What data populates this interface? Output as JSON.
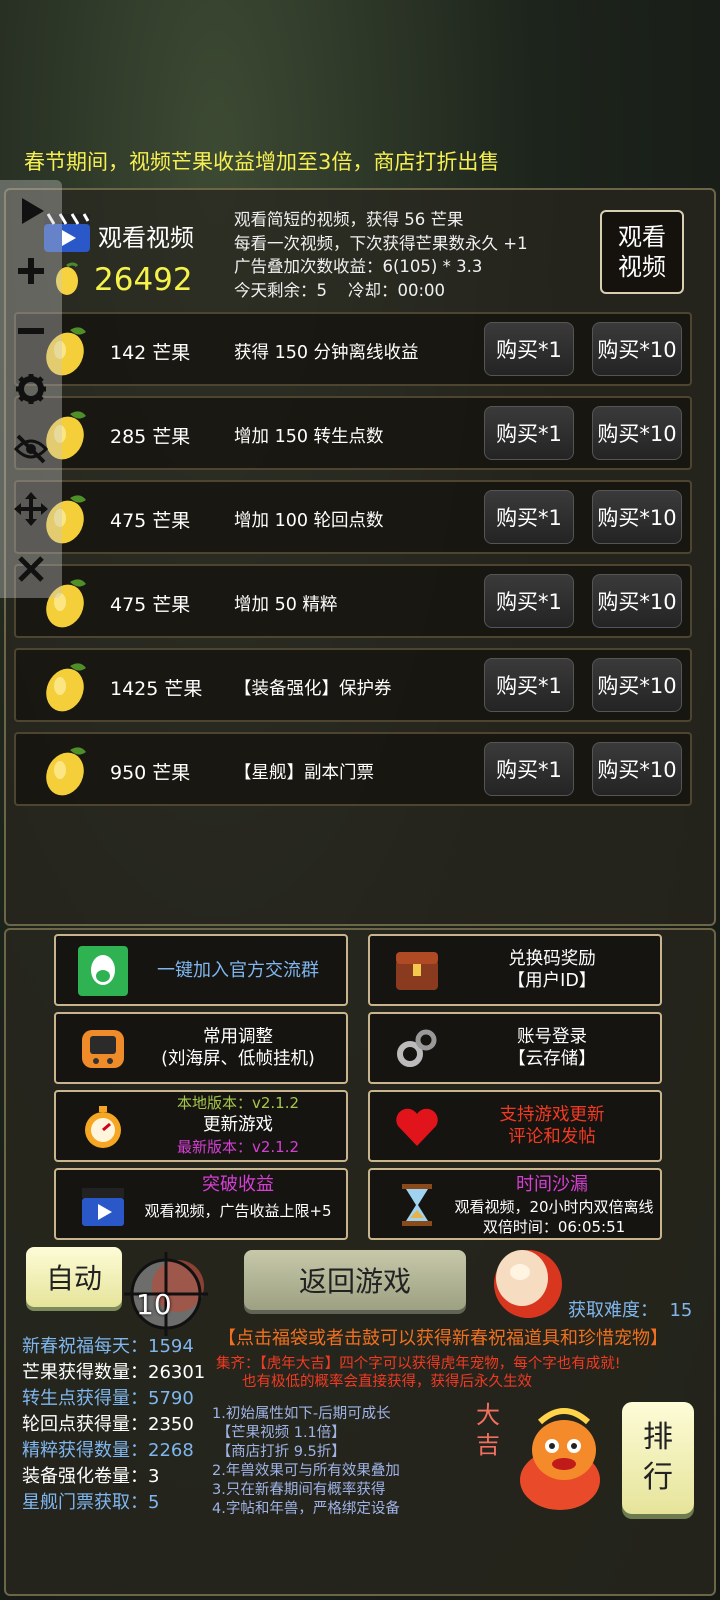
{
  "banner": "春节期间，视频芒果收益增加至3倍，商店打折出售",
  "video": {
    "title": "观看视频",
    "mango_count": "26492",
    "info": [
      "观看简短的视频，获得 56 芒果",
      "每看一次视频，下次获得芒果数永久 +1",
      "广告叠加次数收益：6(105) * 3.3",
      "今天剩余：5    冷却：00:00"
    ],
    "watch_button": "观看\n视频"
  },
  "shop_items": [
    {
      "price": "142 芒果",
      "desc": "获得 150 分钟离线收益",
      "buy1": "购买*1",
      "buy10": "购买*10"
    },
    {
      "price": "285 芒果",
      "desc": "增加 150 转生点数",
      "buy1": "购买*1",
      "buy10": "购买*10"
    },
    {
      "price": "475 芒果",
      "desc": "增加 100 轮回点数",
      "buy1": "购买*1",
      "buy10": "购买*10"
    },
    {
      "price": "475 芒果",
      "desc": "增加 50 精粹",
      "buy1": "购买*1",
      "buy10": "购买*10"
    },
    {
      "price": "1425 芒果",
      "desc": "【装备强化】保护券",
      "buy1": "购买*1",
      "buy10": "购买*10"
    },
    {
      "price": "950 芒果",
      "desc": "【星舰】副本门票",
      "buy1": "购买*1",
      "buy10": "购买*10"
    }
  ],
  "toolbar_icons": [
    "play-icon",
    "plus-icon",
    "minus-icon",
    "gear-icon",
    "eye-off-icon",
    "move-icon",
    "close-icon"
  ],
  "tiles": {
    "join_group": "一键加入官方交流群",
    "redeem_line1": "兑换码奖励",
    "redeem_line2": "【用户ID】",
    "settings_line1": "常用调整",
    "settings_line2": "(刘海屏、低帧挂机)",
    "login_line1": "账号登录",
    "login_line2": "【云存储】",
    "local_version": "本地版本：v2.1.2",
    "update_game": "更新游戏",
    "latest_version": "最新版本：v2.1.2",
    "support_line1": "支持游戏更新",
    "support_line2": "评论和发帖",
    "breakthrough_title": "突破收益",
    "breakthrough_desc": "观看视频，广告收益上限+5",
    "hourglass_title": "时间沙漏",
    "hourglass_desc": "观看视频，20小时内双倍离线",
    "double_time": "双倍时间：06:05:51"
  },
  "auto_button": "自动",
  "return_button": "返回游戏",
  "timer_overlay": "10",
  "difficulty": "获取难度：  15",
  "drum_note": "【点击福袋或者击鼓可以获得新春祝福道具和珍惜宠物】",
  "collect_note_line1": "集齐：【虎年大吉】四个字可以获得虎年宠物，每个字也有成就!",
  "collect_note_line2": "也有极低的概率会直接获得，获得后永久生效",
  "stats": [
    {
      "label": "新春祝福每天：",
      "value": "1594"
    },
    {
      "label": "芒果获得数量：",
      "value": "26301"
    },
    {
      "label": "转生点获得量：",
      "value": "5790"
    },
    {
      "label": "轮回点获得量：",
      "value": "2350"
    },
    {
      "label": "精粹获得数量：",
      "value": "2268"
    },
    {
      "label": "装备强化卷量：",
      "value": "3"
    },
    {
      "label": "星舰门票获取：",
      "value": "5"
    }
  ],
  "rules": "1.初始属性如下-后期可成长\n 【芒果视频 1.1倍】\n 【商店打折 9.5折】\n2.年兽效果可与所有效果叠加\n3.只在新春期间有概率获得\n4.字帖和年兽，严格绑定设备",
  "fortune_chars": "大\n吉",
  "rank_button": "排\n行"
}
